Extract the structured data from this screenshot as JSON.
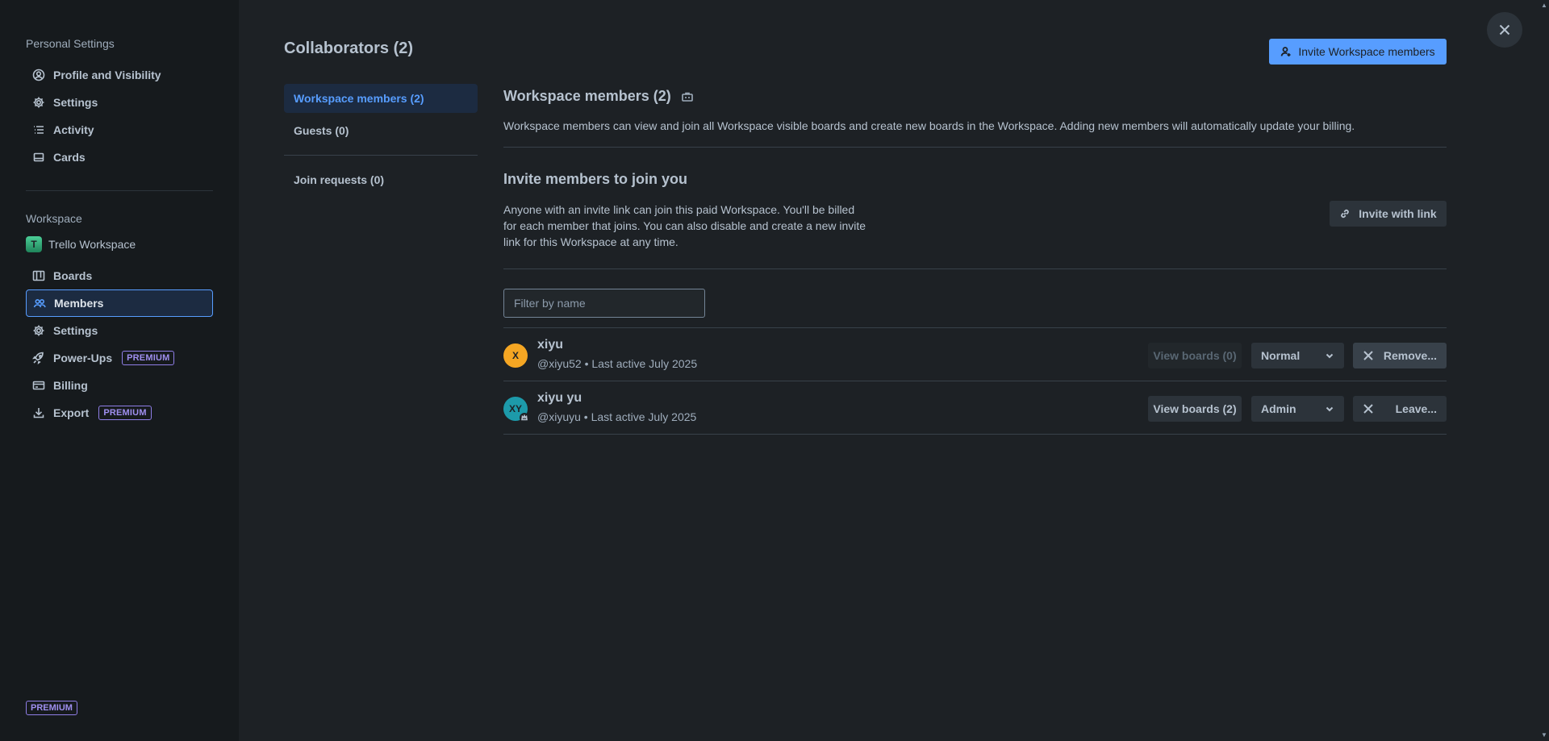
{
  "sidebar": {
    "personal_heading": "Personal Settings",
    "personal_items": [
      {
        "label": "Profile and Visibility",
        "icon": "profile-icon"
      },
      {
        "label": "Settings",
        "icon": "gear-icon"
      },
      {
        "label": "Activity",
        "icon": "activity-icon"
      },
      {
        "label": "Cards",
        "icon": "cards-icon"
      }
    ],
    "workspace_heading": "Workspace",
    "workspace_badge": "T",
    "workspace_name": "Trello Workspace",
    "workspace_items": [
      {
        "label": "Boards",
        "icon": "boards-icon"
      },
      {
        "label": "Members",
        "icon": "members-icon",
        "active": true
      },
      {
        "label": "Settings",
        "icon": "gear-icon"
      },
      {
        "label": "Power-Ups",
        "icon": "rocket-icon",
        "tag": "PREMIUM"
      },
      {
        "label": "Billing",
        "icon": "card-icon"
      },
      {
        "label": "Export",
        "icon": "download-icon",
        "tag": "PREMIUM"
      }
    ],
    "premium_bottom": "PREMIUM"
  },
  "header": {
    "title": "Collaborators (2)",
    "invite_button": "Invite Workspace members"
  },
  "subnav": {
    "items": [
      {
        "label": "Workspace members (2)",
        "active": true
      },
      {
        "label": "Guests (0)"
      },
      {
        "label": "Join requests (0)"
      }
    ]
  },
  "members_section": {
    "title": "Workspace members (2)",
    "description": "Workspace members can view and join all Workspace visible boards and create new boards in the Workspace. Adding new members will automatically update your billing."
  },
  "invite_section": {
    "title": "Invite members to join you",
    "description": "Anyone with an invite link can join this paid Workspace. You'll be billed for each member that joins. You can also disable and create a new invite link for this Workspace at any time.",
    "link_button": "Invite with link"
  },
  "filter": {
    "placeholder": "Filter by name"
  },
  "members": [
    {
      "initials": "X",
      "avatar_color": "#f5a623",
      "name": "xiyu",
      "meta": "@xiyu52 • Last active July 2025",
      "view_boards": "View boards (0)",
      "view_boards_disabled": true,
      "role": "Normal",
      "action": "Remove..."
    },
    {
      "initials": "XY",
      "avatar_color": "#1d9aaa",
      "name": "xiyu yu",
      "meta": "@xiyuyu • Last active July 2025",
      "view_boards": "View boards (2)",
      "view_boards_disabled": false,
      "role": "Admin",
      "action": "Leave..."
    }
  ],
  "colors": {
    "accent": "#579dff",
    "premium": "#8f7ee7",
    "background": "#1d2125",
    "sidebar": "#161a1d"
  }
}
